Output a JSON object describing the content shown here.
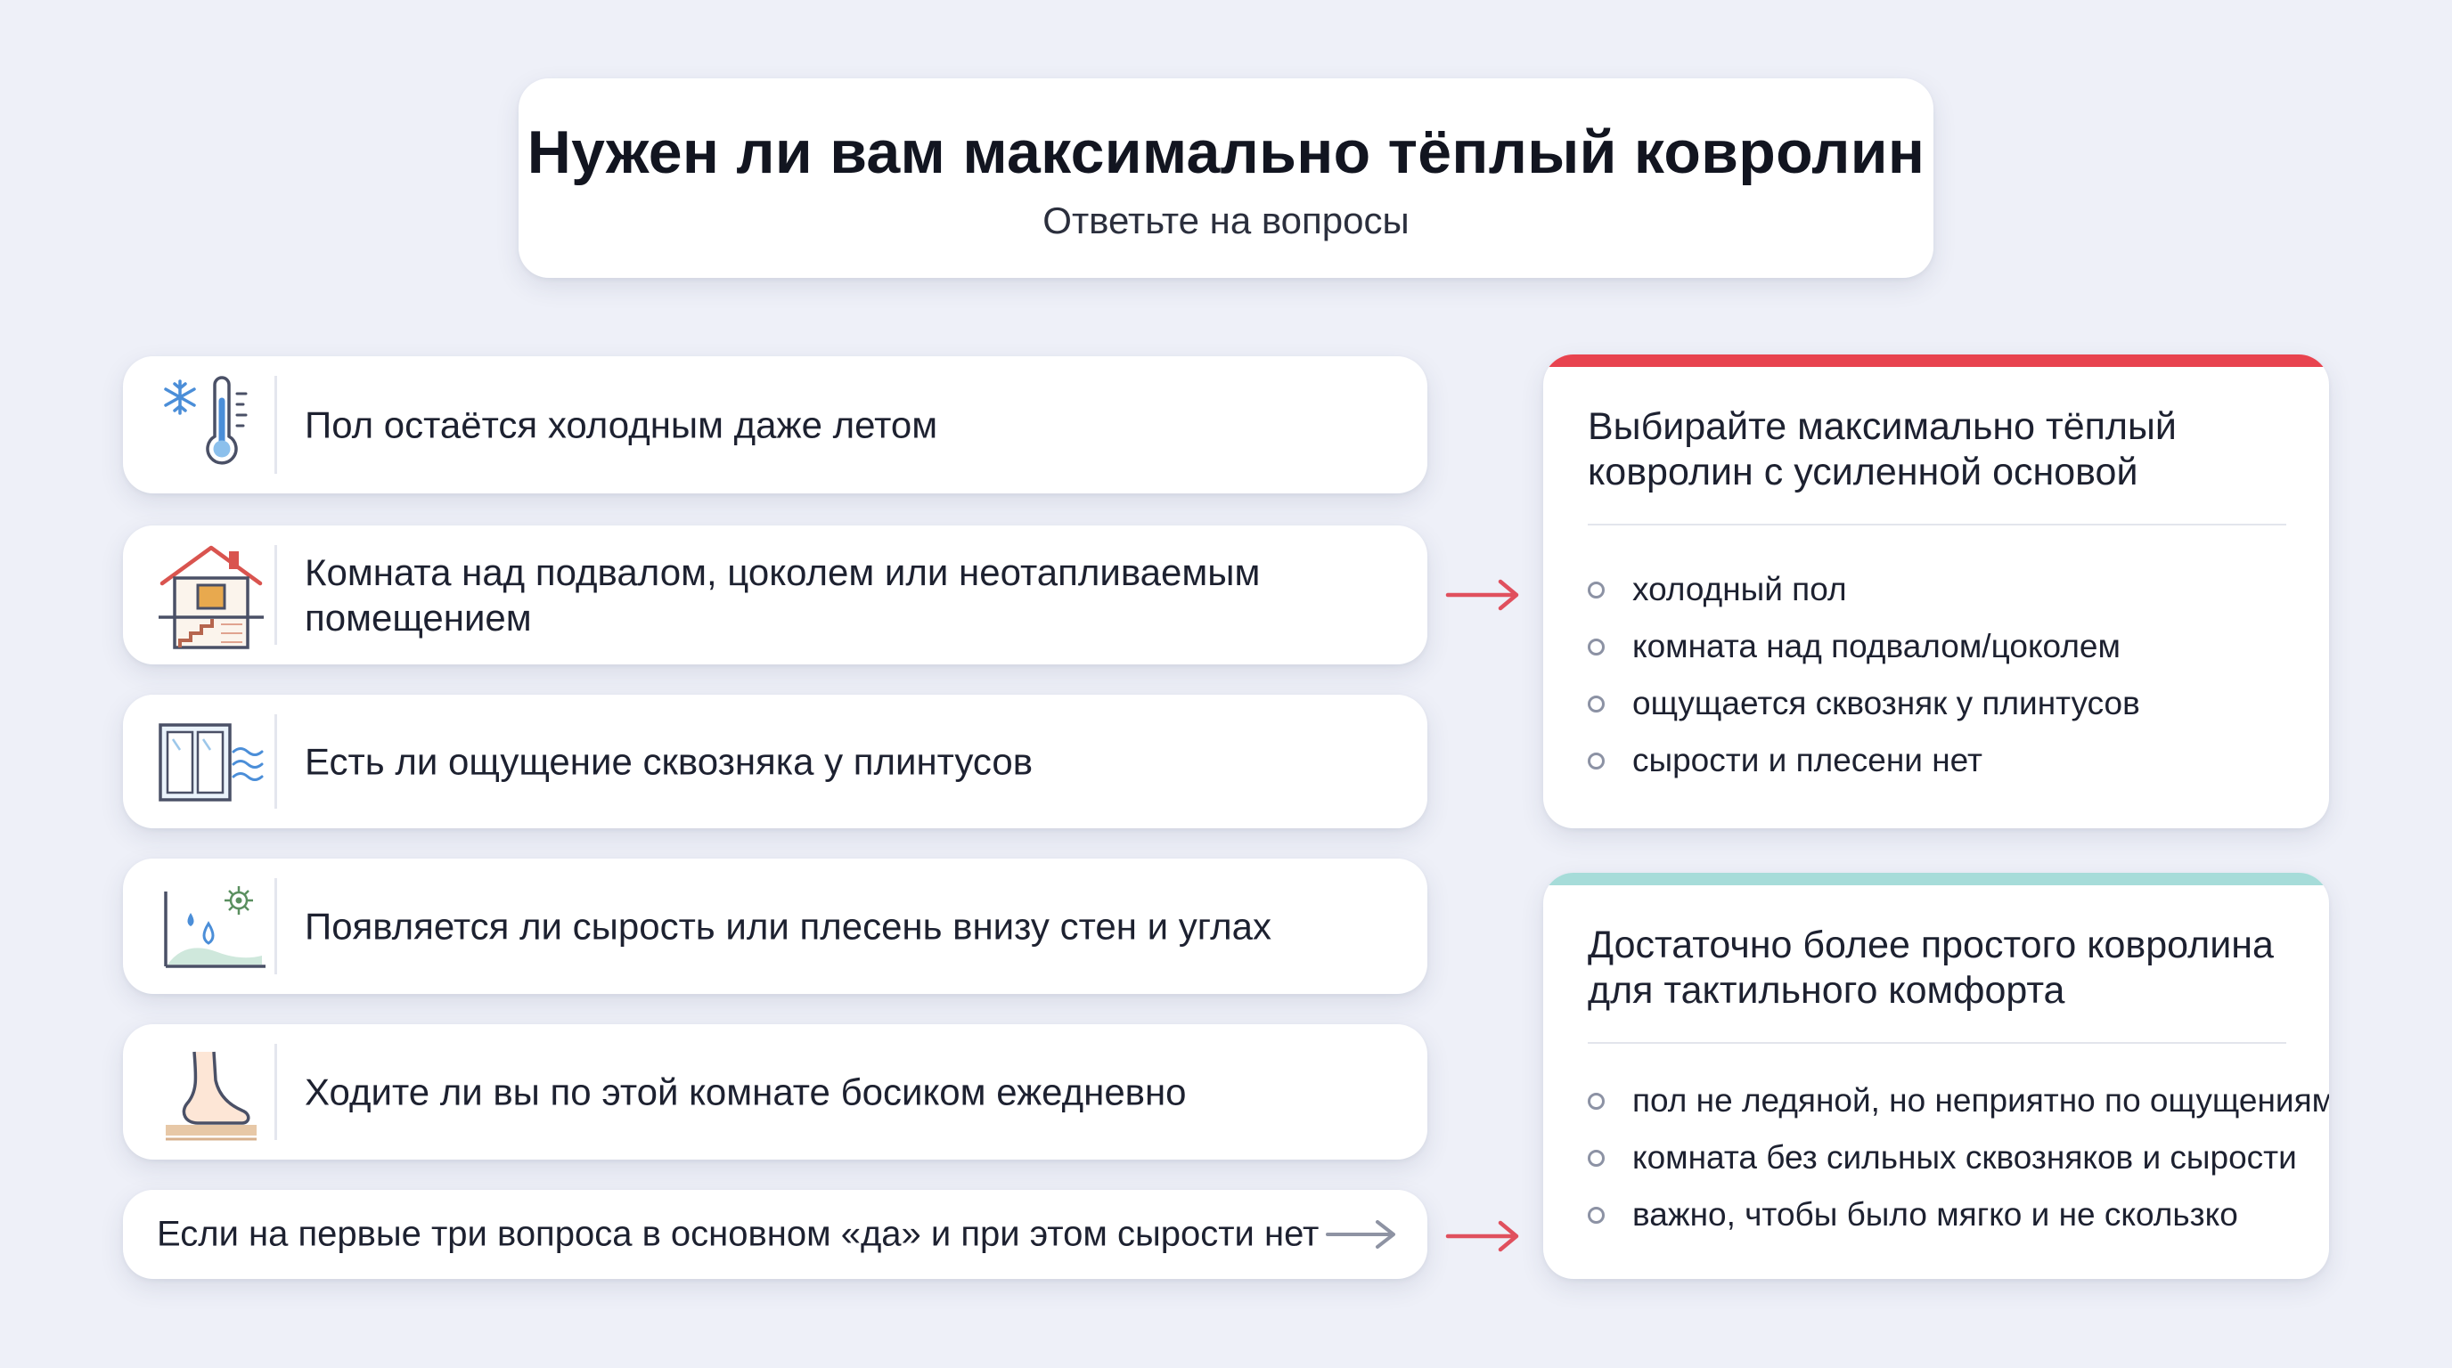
{
  "header": {
    "title": "Нужен ли вам максимально тёплый ковролин",
    "subtitle": "Ответьте на вопросы"
  },
  "questions": [
    {
      "text": "Пол остаётся холодным даже летом",
      "icon": "thermometer-snowflake-icon"
    },
    {
      "text": "Комната над подвалом, цоколем или неотапливаемым помещением",
      "icon": "house-basement-icon"
    },
    {
      "text": "Есть ли ощущение сквозняка у плинтусов",
      "icon": "window-draft-icon"
    },
    {
      "text": "Появляется ли сырость или плесень внизу стен и углах",
      "icon": "damp-mold-corner-icon"
    },
    {
      "text": "Ходите ли вы по этой комнате босиком ежедневно",
      "icon": "bare-foot-icon"
    }
  ],
  "summary_note": "Если на первые три вопроса в основном «да» и при этом сырости нет",
  "results": [
    {
      "title": "Выбирайте максимально тёплый ковролин с усиленной основой",
      "accent": "#e8434f",
      "items": [
        "холодный пол",
        "комната над подвалом/цоколем",
        "ощущается сквозняк у плинтусов",
        "сырости и плесени нет"
      ]
    },
    {
      "title": "Достаточно более простого ковролина для тактильного комфорта",
      "accent": "#a6dcd9",
      "items": [
        "пол не ледяной, но неприятно по ощущениям",
        "комната без сильных сквозняков и сырости",
        "важно, чтобы было мягко и не скользко"
      ]
    }
  ],
  "colors": {
    "background": "#eef0f8",
    "arrow_red": "#e0505e",
    "arrow_gray": "#8e93a3",
    "icon_stroke": "#4a5066",
    "icon_blue": "#4b8ed8",
    "icon_red": "#d9544f"
  }
}
